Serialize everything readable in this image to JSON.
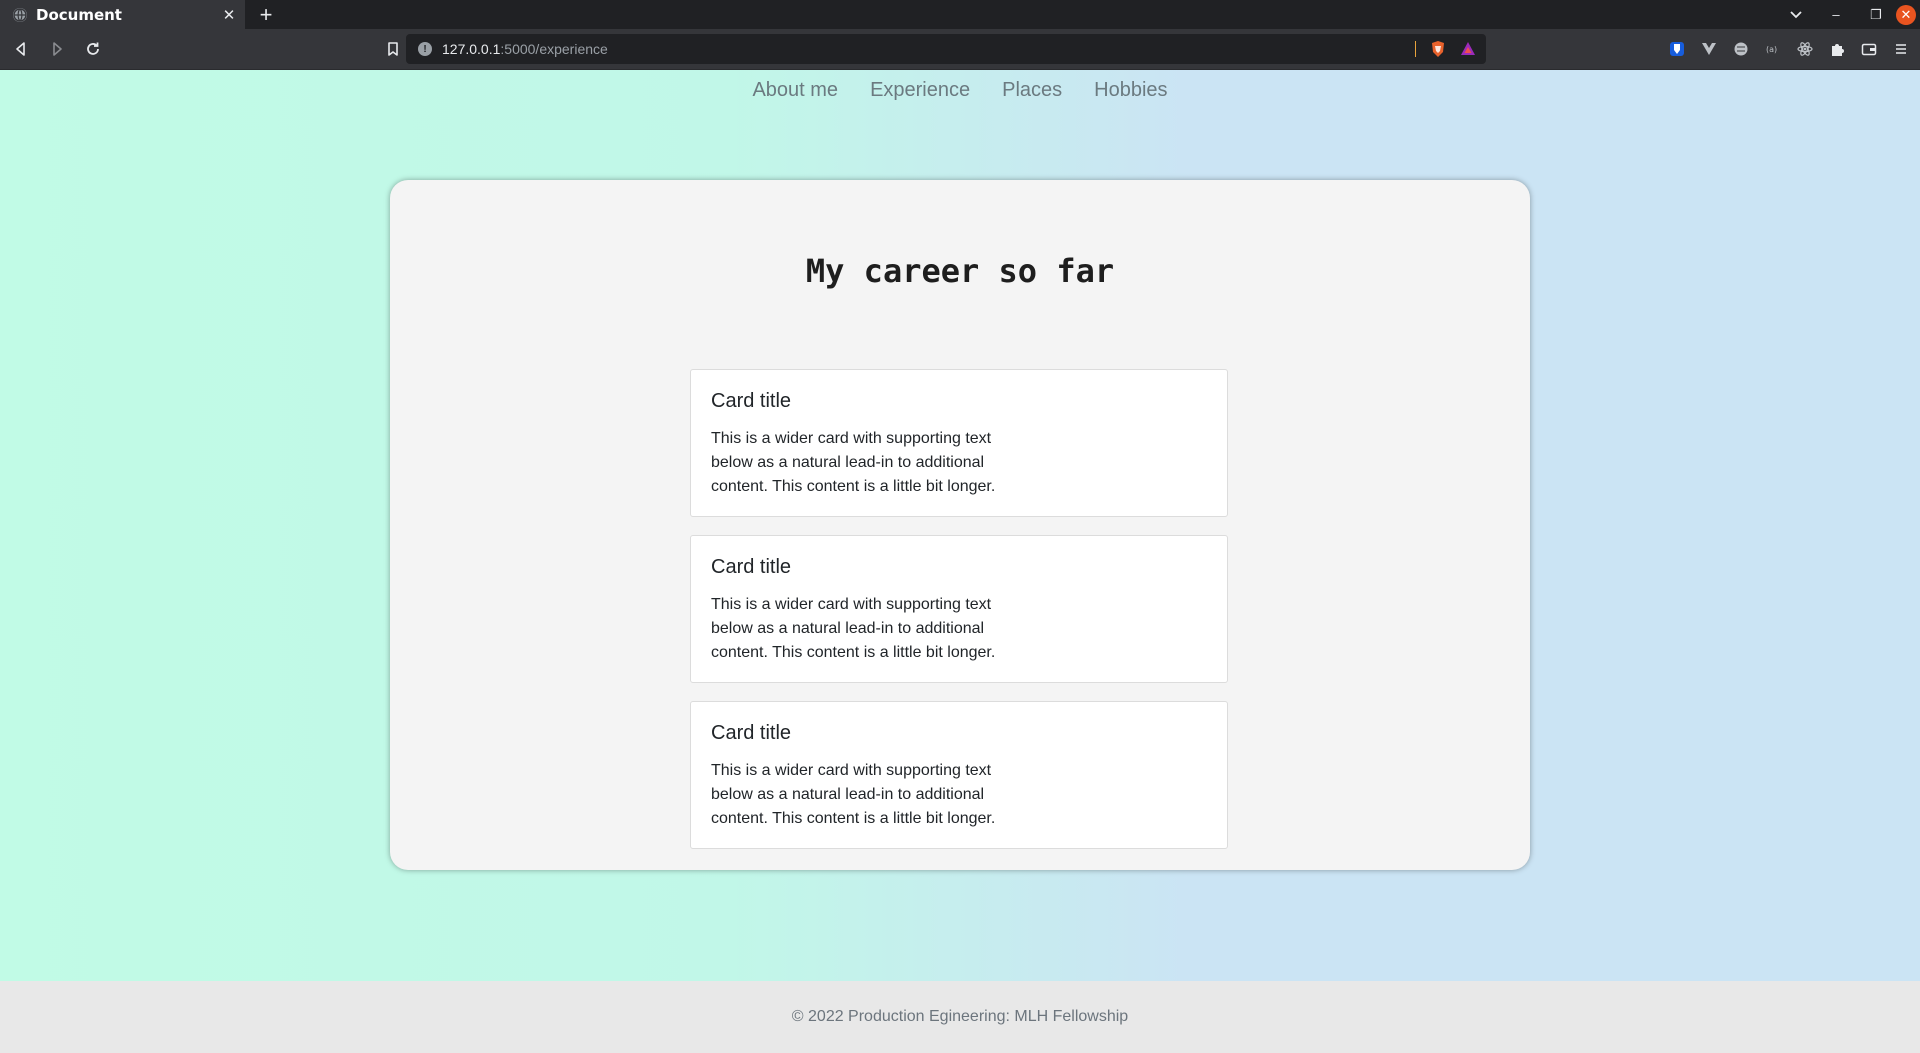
{
  "browser": {
    "tab_title": "Document",
    "tab_close": "✕",
    "new_tab": "+",
    "url_host": "127.0.0.1",
    "url_path": ":5000/experience",
    "window_controls": {
      "minimize": "–",
      "restore": "❐",
      "close": "✕"
    }
  },
  "site_nav": {
    "items": [
      {
        "label": "About me"
      },
      {
        "label": "Experience"
      },
      {
        "label": "Places"
      },
      {
        "label": "Hobbies"
      }
    ]
  },
  "main": {
    "title": "My career so far",
    "cards": [
      {
        "title": "Card title",
        "text": "This is a wider card with supporting text below as a natural lead-in to additional content. This content is a little bit longer."
      },
      {
        "title": "Card title",
        "text": "This is a wider card with supporting text below as a natural lead-in to additional content. This content is a little bit longer."
      },
      {
        "title": "Card title",
        "text": "This is a wider card with supporting text below as a natural lead-in to additional content. This content is a little bit longer."
      }
    ]
  },
  "footer": {
    "text": "© 2022 Production Egineering: MLH Fellowship"
  },
  "colors": {
    "gradient_left": "#c1fbe6",
    "gradient_right": "#cbe4f4",
    "panel_bg": "#f4f4f4",
    "footer_bg": "#e8e8e8",
    "nav_text": "#6b7a80",
    "brave_orange": "#e8a33d",
    "ubuntu_close": "#e95420"
  }
}
